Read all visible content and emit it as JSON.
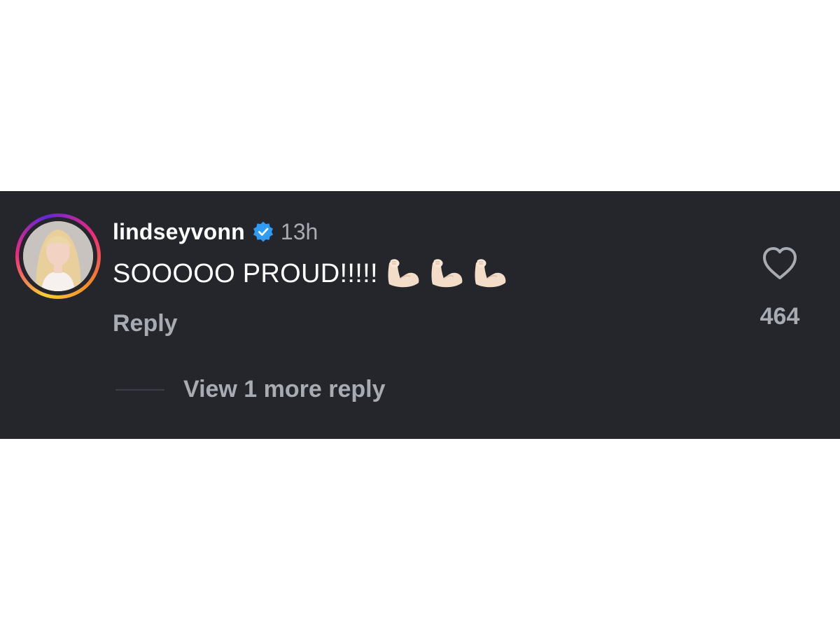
{
  "comment": {
    "username": "lindseyvonn",
    "verified": true,
    "timestamp": "13h",
    "text": "SOOOOO PROUD!!!!!",
    "emojis": [
      "flexed-biceps",
      "flexed-biceps",
      "flexed-biceps"
    ],
    "reply_label": "Reply",
    "like_count": "464",
    "view_replies_label": "View 1 more reply"
  },
  "colors": {
    "background": "#24262c",
    "primary_text": "#ffffff",
    "secondary_text": "#a8abb2",
    "verified_badge": "#2f9bf4"
  },
  "icons": {
    "verified": "verified-badge-icon",
    "like": "heart-outline-icon",
    "emoji": "flexed-biceps-icon"
  }
}
